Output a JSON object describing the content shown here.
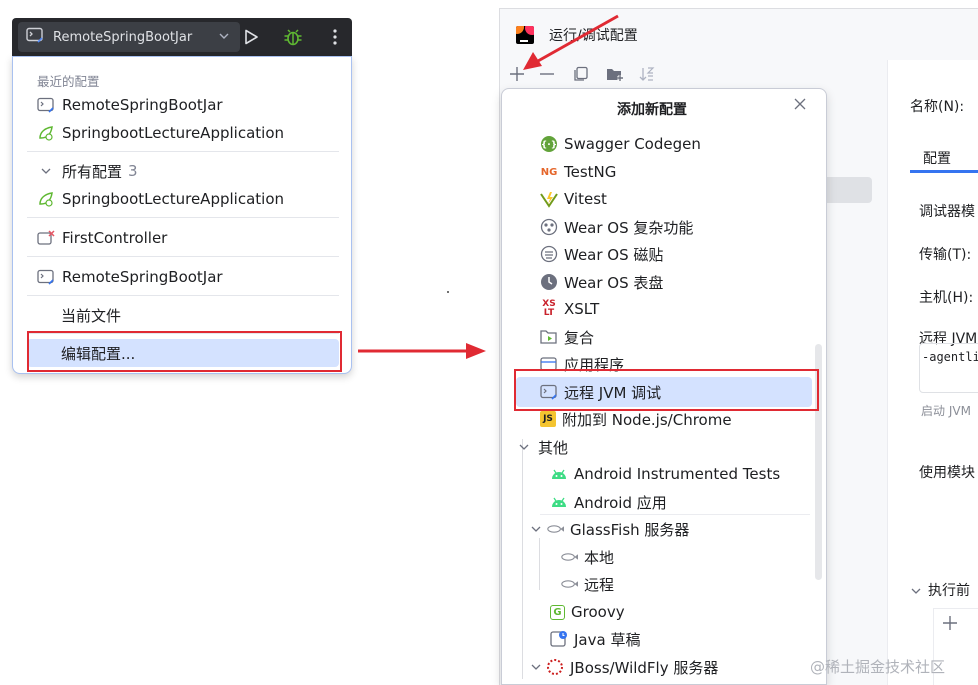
{
  "run_widget": {
    "config_name": "RemoteSpringBootJar",
    "colors": {
      "toolbar_bg": "#27282c",
      "debug_icon": "#5fb832",
      "highlight": "#d4e2ff",
      "annotation_red": "#e02a33"
    }
  },
  "run_dropdown": {
    "recent_header": "最近的配置",
    "recent_items": [
      "RemoteSpringBootJar",
      "SpringbootLectureApplication"
    ],
    "all_configs_label": "所有配置",
    "all_configs_count": "3",
    "group_item": "SpringbootLectureApplication",
    "first_controller": "FirstController",
    "remote_item": "RemoteSpringBootJar",
    "current_file": "当前文件",
    "edit_configs": "编辑配置..."
  },
  "dialog": {
    "title": "运行/调试配置",
    "right_panel": {
      "name_label": "名称(N):",
      "tab_config": "配置",
      "debugger_mode": "调试器模",
      "transport": "传输(T):",
      "host": "主机(H):",
      "remote_jvm": "远程 JVM",
      "agent_arg": "-agentli",
      "start_jvm": "启动 JVM",
      "use_module": "使用模块",
      "before_launch": "执行前"
    }
  },
  "add_config_popup": {
    "title": "添加新配置",
    "items": [
      {
        "label": "Swagger Codegen",
        "icon": "swagger-icon"
      },
      {
        "label": "TestNG",
        "icon": "testng-icon"
      },
      {
        "label": "Vitest",
        "icon": "vitest-icon"
      },
      {
        "label": "Wear OS 复杂功能",
        "icon": "wear-os-complication-icon"
      },
      {
        "label": "Wear OS 磁贴",
        "icon": "wear-os-tile-icon"
      },
      {
        "label": "Wear OS 表盘",
        "icon": "wear-os-watchface-icon"
      },
      {
        "label": "XSLT",
        "icon": "xslt-icon"
      },
      {
        "label": "复合",
        "icon": "compound-icon"
      },
      {
        "label": "应用程序",
        "icon": "application-icon"
      },
      {
        "label": "远程 JVM 调试",
        "icon": "remote-jvm-debug-icon"
      },
      {
        "label": "附加到 Node.js/Chrome",
        "icon": "nodejs-attach-icon"
      }
    ],
    "other_group": "其他",
    "other_items": [
      "Android Instrumented Tests",
      "Android 应用"
    ],
    "glassfish": "GlassFish 服务器",
    "glassfish_children": [
      "本地",
      "远程"
    ],
    "groovy": "Groovy",
    "java_draft": "Java 草稿",
    "jboss": "JBoss/WildFly 服务器"
  },
  "watermark": "@稀土掘金技术社区"
}
